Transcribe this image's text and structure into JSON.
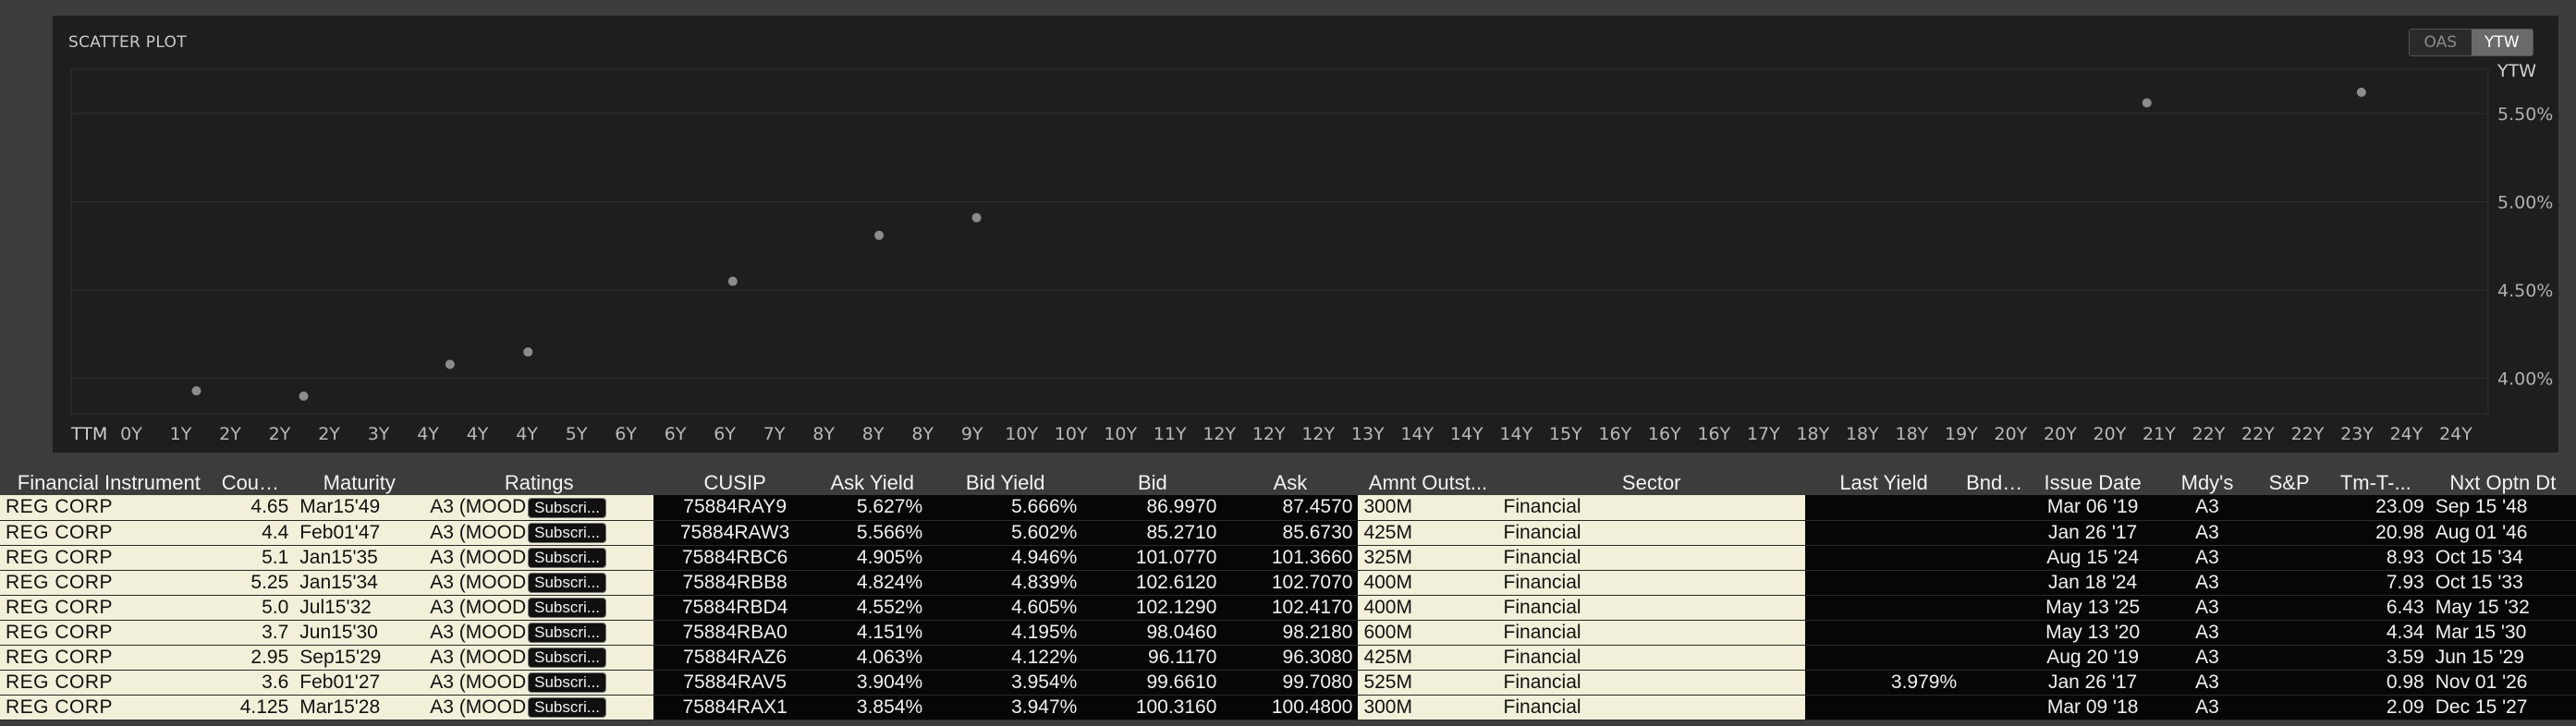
{
  "chart": {
    "title": "SCATTER PLOT",
    "toggle": [
      {
        "label": "OAS",
        "active": false
      },
      {
        "label": "YTW",
        "active": true
      }
    ]
  },
  "chart_data": {
    "type": "scatter",
    "title": "SCATTER PLOT",
    "xlabel": "TTM",
    "ylabel": "YTW",
    "x_unit": "years to maturity",
    "xlim": [
      0,
      24.5
    ],
    "ylim": [
      3.8,
      5.75
    ],
    "x_tick_labels": [
      "0Y",
      "1Y",
      "2Y",
      "2Y",
      "2Y",
      "3Y",
      "4Y",
      "4Y",
      "4Y",
      "5Y",
      "6Y",
      "6Y",
      "6Y",
      "7Y",
      "8Y",
      "8Y",
      "8Y",
      "9Y",
      "10Y",
      "10Y",
      "10Y",
      "11Y",
      "12Y",
      "12Y",
      "12Y",
      "13Y",
      "14Y",
      "14Y",
      "14Y",
      "15Y",
      "16Y",
      "16Y",
      "16Y",
      "17Y",
      "18Y",
      "18Y",
      "18Y",
      "19Y",
      "20Y",
      "20Y",
      "20Y",
      "21Y",
      "22Y",
      "22Y",
      "22Y",
      "23Y",
      "24Y",
      "24Y"
    ],
    "y_ticks": [
      4.0,
      4.5,
      5.0,
      5.5
    ],
    "y_tick_labels": [
      "4.00%",
      "4.50%",
      "5.00%",
      "5.50%"
    ],
    "grid": true,
    "points": [
      {
        "x": 1.0,
        "y": 3.93
      },
      {
        "x": 2.1,
        "y": 3.9
      },
      {
        "x": 3.6,
        "y": 4.08
      },
      {
        "x": 4.4,
        "y": 4.15
      },
      {
        "x": 6.5,
        "y": 4.55
      },
      {
        "x": 8.0,
        "y": 4.81
      },
      {
        "x": 9.0,
        "y": 4.91
      },
      {
        "x": 21.0,
        "y": 5.56
      },
      {
        "x": 23.2,
        "y": 5.62
      }
    ],
    "point_color": "#8c8c8c"
  },
  "table": {
    "columns": [
      "Financial Instrument",
      "Coupon",
      "Maturity",
      "Ratings",
      "CUSIP",
      "Ask Yield",
      "Bid Yield",
      "Bid",
      "Ask",
      "Amnt Outst...",
      "Sector",
      "Last Yield",
      "Bnd ...",
      "Issue Date",
      "Mdy's",
      "S&P",
      "Tm-T-...",
      "Nxt Optn Dt"
    ],
    "rows": [
      {
        "instrument": "REG CORP",
        "coupon": "4.65",
        "maturity": "Mar15'49",
        "rating": "A3 (MOOD",
        "subscr": "Subscri...",
        "cusip": "75884RAY9",
        "ask_yield": "5.627%",
        "bid_yield": "5.666%",
        "bid": "86.9970",
        "ask": "87.4570",
        "amnt": "300M",
        "sector": "Financial",
        "last_yield": "",
        "bnd": "",
        "issue_date": "Mar 06 '19",
        "mdys": "A3",
        "sp": "",
        "ttm": "23.09",
        "next_opt": "Sep 15 '48"
      },
      {
        "instrument": "REG CORP",
        "coupon": "4.4",
        "maturity": "Feb01'47",
        "rating": "A3 (MOOD",
        "subscr": "Subscri...",
        "cusip": "75884RAW3",
        "ask_yield": "5.566%",
        "bid_yield": "5.602%",
        "bid": "85.2710",
        "ask": "85.6730",
        "amnt": "425M",
        "sector": "Financial",
        "last_yield": "",
        "bnd": "",
        "issue_date": "Jan 26 '17",
        "mdys": "A3",
        "sp": "",
        "ttm": "20.98",
        "next_opt": "Aug 01 '46"
      },
      {
        "instrument": "REG CORP",
        "coupon": "5.1",
        "maturity": "Jan15'35",
        "rating": "A3 (MOOD",
        "subscr": "Subscri...",
        "cusip": "75884RBC6",
        "ask_yield": "4.905%",
        "bid_yield": "4.946%",
        "bid": "101.0770",
        "ask": "101.3660",
        "amnt": "325M",
        "sector": "Financial",
        "last_yield": "",
        "bnd": "",
        "issue_date": "Aug 15 '24",
        "mdys": "A3",
        "sp": "",
        "ttm": "8.93",
        "next_opt": "Oct 15 '34"
      },
      {
        "instrument": "REG CORP",
        "coupon": "5.25",
        "maturity": "Jan15'34",
        "rating": "A3 (MOOD",
        "subscr": "Subscri...",
        "cusip": "75884RBB8",
        "ask_yield": "4.824%",
        "bid_yield": "4.839%",
        "bid": "102.6120",
        "ask": "102.7070",
        "amnt": "400M",
        "sector": "Financial",
        "last_yield": "",
        "bnd": "",
        "issue_date": "Jan 18 '24",
        "mdys": "A3",
        "sp": "",
        "ttm": "7.93",
        "next_opt": "Oct 15 '33"
      },
      {
        "instrument": "REG CORP",
        "coupon": "5.0",
        "maturity": "Jul15'32",
        "rating": "A3 (MOOD",
        "subscr": "Subscri...",
        "cusip": "75884RBD4",
        "ask_yield": "4.552%",
        "bid_yield": "4.605%",
        "bid": "102.1290",
        "ask": "102.4170",
        "amnt": "400M",
        "sector": "Financial",
        "last_yield": "",
        "bnd": "",
        "issue_date": "May 13 '25",
        "mdys": "A3",
        "sp": "",
        "ttm": "6.43",
        "next_opt": "May 15 '32"
      },
      {
        "instrument": "REG CORP",
        "coupon": "3.7",
        "maturity": "Jun15'30",
        "rating": "A3 (MOOD",
        "subscr": "Subscri...",
        "cusip": "75884RBA0",
        "ask_yield": "4.151%",
        "bid_yield": "4.195%",
        "bid": "98.0460",
        "ask": "98.2180",
        "amnt": "600M",
        "sector": "Financial",
        "last_yield": "",
        "bnd": "",
        "issue_date": "May 13 '20",
        "mdys": "A3",
        "sp": "",
        "ttm": "4.34",
        "next_opt": "Mar 15 '30"
      },
      {
        "instrument": "REG CORP",
        "coupon": "2.95",
        "maturity": "Sep15'29",
        "rating": "A3 (MOOD",
        "subscr": "Subscri...",
        "cusip": "75884RAZ6",
        "ask_yield": "4.063%",
        "bid_yield": "4.122%",
        "bid": "96.1170",
        "ask": "96.3080",
        "amnt": "425M",
        "sector": "Financial",
        "last_yield": "",
        "bnd": "",
        "issue_date": "Aug 20 '19",
        "mdys": "A3",
        "sp": "",
        "ttm": "3.59",
        "next_opt": "Jun 15 '29"
      },
      {
        "instrument": "REG CORP",
        "coupon": "3.6",
        "maturity": "Feb01'27",
        "rating": "A3 (MOOD",
        "subscr": "Subscri...",
        "cusip": "75884RAV5",
        "ask_yield": "3.904%",
        "bid_yield": "3.954%",
        "bid": "99.6610",
        "ask": "99.7080",
        "amnt": "525M",
        "sector": "Financial",
        "last_yield": "3.979%",
        "bnd": "",
        "issue_date": "Jan 26 '17",
        "mdys": "A3",
        "sp": "",
        "ttm": "0.98",
        "next_opt": "Nov 01 '26"
      },
      {
        "instrument": "REG CORP",
        "coupon": "4.125",
        "maturity": "Mar15'28",
        "rating": "A3 (MOOD",
        "subscr": "Subscri...",
        "cusip": "75884RAX1",
        "ask_yield": "3.854%",
        "bid_yield": "3.947%",
        "bid": "100.3160",
        "ask": "100.4800",
        "amnt": "300M",
        "sector": "Financial",
        "last_yield": "",
        "bnd": "",
        "issue_date": "Mar 09 '18",
        "mdys": "A3",
        "sp": "",
        "ttm": "2.09",
        "next_opt": "Dec 15 '27"
      }
    ]
  }
}
